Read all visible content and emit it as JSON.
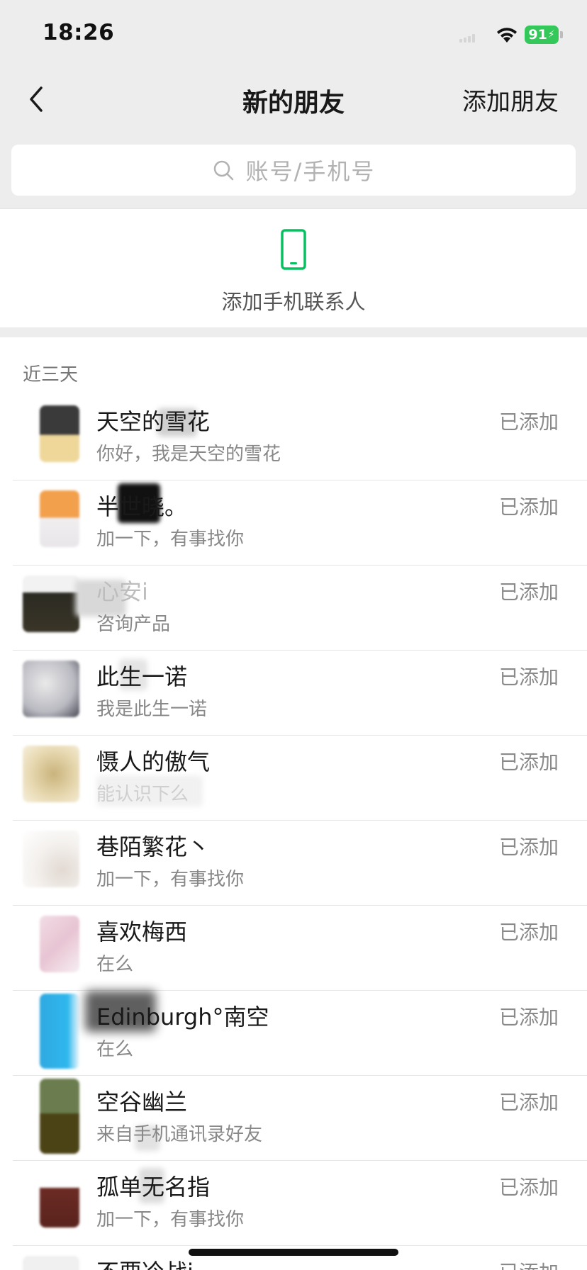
{
  "status_bar": {
    "time": "18:26",
    "battery": "91",
    "colors": {
      "battery": "#34c759"
    }
  },
  "nav": {
    "title": "新的朋友",
    "action": "添加朋友"
  },
  "search": {
    "placeholder": "账号/手机号"
  },
  "contacts_entry": {
    "label": "添加手机联系人",
    "icon": "mobile-phone-icon",
    "color": "#07c160"
  },
  "section": {
    "header": "近三天"
  },
  "requests": [
    {
      "name": "天空的雪花",
      "message": "你好，我是天空的雪花",
      "status": "已添加"
    },
    {
      "name": "半世晓。",
      "message": "加一下，有事找你",
      "status": "已添加"
    },
    {
      "name": "心安i",
      "message": "咨询产品",
      "status": "已添加"
    },
    {
      "name": "此生一诺",
      "message": "我是此生一诺",
      "status": "已添加"
    },
    {
      "name": "慑人的傲气",
      "message": "能认识下么",
      "status": "已添加"
    },
    {
      "name": "巷陌繁花丶",
      "message": "加一下，有事找你",
      "status": "已添加"
    },
    {
      "name": "喜欢梅西",
      "message": "在么",
      "status": "已添加"
    },
    {
      "name": "Edinburgh°南空",
      "message": "在么",
      "status": "已添加"
    },
    {
      "name": "空谷幽兰",
      "message": "来自手机通讯录好友",
      "status": "已添加"
    },
    {
      "name": "孤单无名指",
      "message": "加一下，有事找你",
      "status": "已添加"
    },
    {
      "name": "不要冷战i",
      "message": "",
      "status": "已添加"
    }
  ]
}
